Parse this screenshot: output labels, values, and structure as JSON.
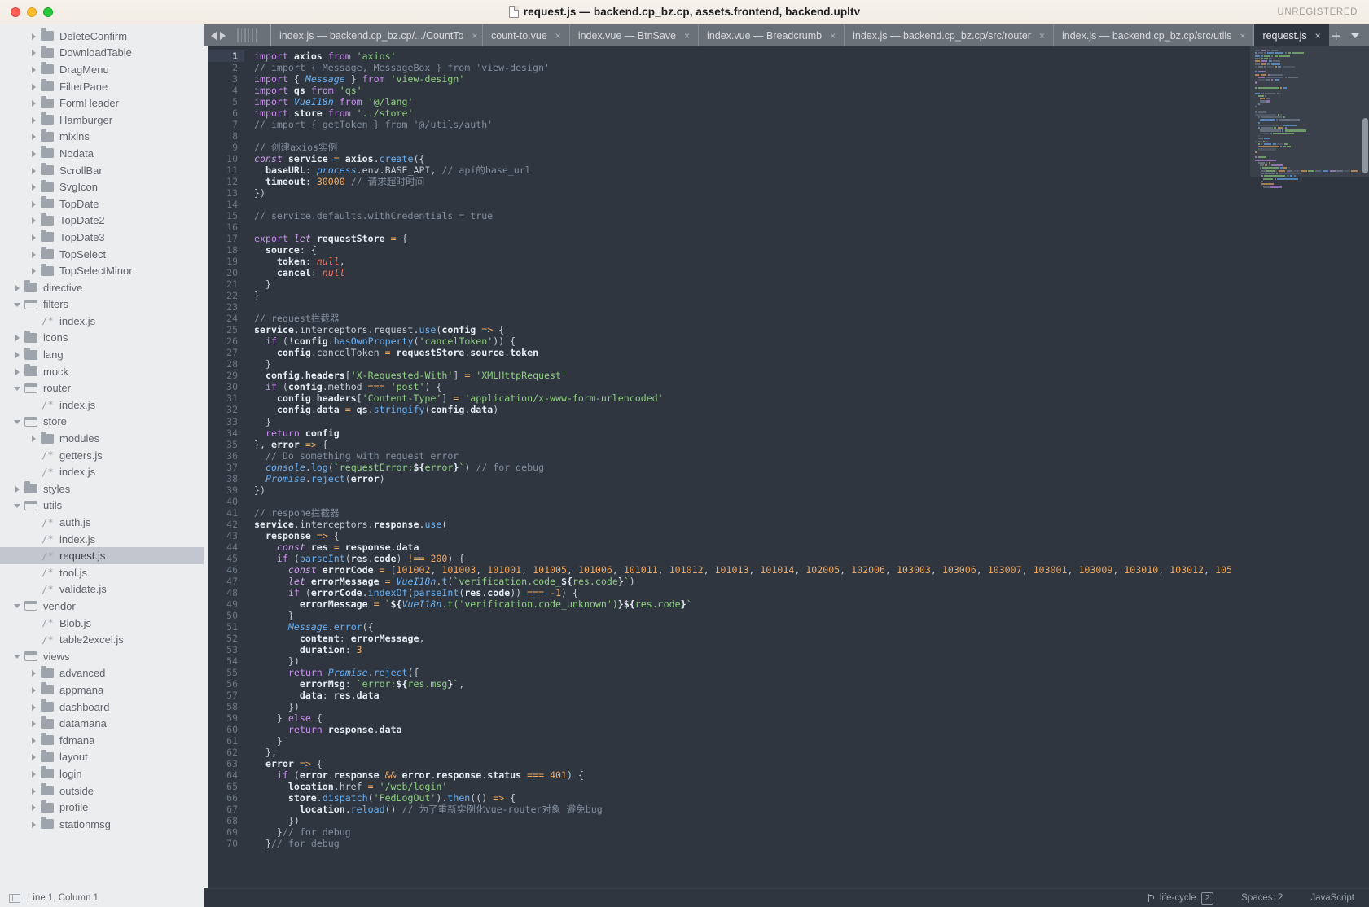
{
  "window": {
    "title": "request.js — backend.cp_bz.cp, assets.frontend, backend.upltv",
    "license": "UNREGISTERED",
    "doc_icon": "document-icon",
    "traffic_lights": [
      "close-button",
      "minimize-button",
      "zoom-button"
    ]
  },
  "sidebar": {
    "items": [
      {
        "label": "DeleteConfirm",
        "type": "folder",
        "state": "collapsed",
        "depth": 2
      },
      {
        "label": "DownloadTable",
        "type": "folder",
        "state": "collapsed",
        "depth": 2
      },
      {
        "label": "DragMenu",
        "type": "folder",
        "state": "collapsed",
        "depth": 2
      },
      {
        "label": "FilterPane",
        "type": "folder",
        "state": "collapsed",
        "depth": 2
      },
      {
        "label": "FormHeader",
        "type": "folder",
        "state": "collapsed",
        "depth": 2
      },
      {
        "label": "Hamburger",
        "type": "folder",
        "state": "collapsed",
        "depth": 2
      },
      {
        "label": "mixins",
        "type": "folder",
        "state": "collapsed",
        "depth": 2
      },
      {
        "label": "Nodata",
        "type": "folder",
        "state": "collapsed",
        "depth": 2
      },
      {
        "label": "ScrollBar",
        "type": "folder",
        "state": "collapsed",
        "depth": 2
      },
      {
        "label": "SvgIcon",
        "type": "folder",
        "state": "collapsed",
        "depth": 2
      },
      {
        "label": "TopDate",
        "type": "folder",
        "state": "collapsed",
        "depth": 2
      },
      {
        "label": "TopDate2",
        "type": "folder",
        "state": "collapsed",
        "depth": 2
      },
      {
        "label": "TopDate3",
        "type": "folder",
        "state": "collapsed",
        "depth": 2
      },
      {
        "label": "TopSelect",
        "type": "folder",
        "state": "collapsed",
        "depth": 2
      },
      {
        "label": "TopSelectMinor",
        "type": "folder",
        "state": "collapsed",
        "depth": 2
      },
      {
        "label": "directive",
        "type": "folder",
        "state": "collapsed",
        "depth": 1
      },
      {
        "label": "filters",
        "type": "folder",
        "state": "expanded",
        "depth": 1
      },
      {
        "label": "index.js",
        "type": "file",
        "state": "none",
        "depth": 2
      },
      {
        "label": "icons",
        "type": "folder",
        "state": "collapsed",
        "depth": 1
      },
      {
        "label": "lang",
        "type": "folder",
        "state": "collapsed",
        "depth": 1
      },
      {
        "label": "mock",
        "type": "folder",
        "state": "collapsed",
        "depth": 1
      },
      {
        "label": "router",
        "type": "folder",
        "state": "expanded",
        "depth": 1
      },
      {
        "label": "index.js",
        "type": "file",
        "state": "none",
        "depth": 2
      },
      {
        "label": "store",
        "type": "folder",
        "state": "expanded",
        "depth": 1
      },
      {
        "label": "modules",
        "type": "folder",
        "state": "collapsed",
        "depth": 2
      },
      {
        "label": "getters.js",
        "type": "file",
        "state": "none",
        "depth": 2
      },
      {
        "label": "index.js",
        "type": "file",
        "state": "none",
        "depth": 2
      },
      {
        "label": "styles",
        "type": "folder",
        "state": "collapsed",
        "depth": 1
      },
      {
        "label": "utils",
        "type": "folder",
        "state": "expanded",
        "depth": 1
      },
      {
        "label": "auth.js",
        "type": "file",
        "state": "none",
        "depth": 2
      },
      {
        "label": "index.js",
        "type": "file",
        "state": "none",
        "depth": 2
      },
      {
        "label": "request.js",
        "type": "file",
        "state": "none",
        "depth": 2,
        "selected": true
      },
      {
        "label": "tool.js",
        "type": "file",
        "state": "none",
        "depth": 2
      },
      {
        "label": "validate.js",
        "type": "file",
        "state": "none",
        "depth": 2
      },
      {
        "label": "vendor",
        "type": "folder",
        "state": "expanded",
        "depth": 1
      },
      {
        "label": "Blob.js",
        "type": "file",
        "state": "none",
        "depth": 2
      },
      {
        "label": "table2excel.js",
        "type": "file",
        "state": "none",
        "depth": 2
      },
      {
        "label": "views",
        "type": "folder",
        "state": "expanded",
        "depth": 1
      },
      {
        "label": "advanced",
        "type": "folder",
        "state": "collapsed",
        "depth": 2
      },
      {
        "label": "appmana",
        "type": "folder",
        "state": "collapsed",
        "depth": 2
      },
      {
        "label": "dashboard",
        "type": "folder",
        "state": "collapsed",
        "depth": 2
      },
      {
        "label": "datamana",
        "type": "folder",
        "state": "collapsed",
        "depth": 2
      },
      {
        "label": "fdmana",
        "type": "folder",
        "state": "collapsed",
        "depth": 2
      },
      {
        "label": "layout",
        "type": "folder",
        "state": "collapsed",
        "depth": 2
      },
      {
        "label": "login",
        "type": "folder",
        "state": "collapsed",
        "depth": 2
      },
      {
        "label": "outside",
        "type": "folder",
        "state": "collapsed",
        "depth": 2
      },
      {
        "label": "profile",
        "type": "folder",
        "state": "collapsed",
        "depth": 2
      },
      {
        "label": "stationmsg",
        "type": "folder",
        "state": "collapsed",
        "depth": 2
      }
    ]
  },
  "tabbar": {
    "nav_prev": "◀",
    "nav_next": "▶",
    "new_tab_label": "+",
    "overflow_label": "▼",
    "tabs": [
      {
        "label": "index.js",
        "clipped": true,
        "active": false,
        "close": "×"
      },
      {
        "label": "index.js — backend.cp_bz.cp/.../CountTo",
        "active": false,
        "close": "×"
      },
      {
        "label": "count-to.vue",
        "active": false,
        "close": "×"
      },
      {
        "label": "index.vue — BtnSave",
        "active": false,
        "close": "×"
      },
      {
        "label": "index.vue — Breadcrumb",
        "active": false,
        "close": "×"
      },
      {
        "label": "index.js — backend.cp_bz.cp/src/router",
        "active": false,
        "close": "×"
      },
      {
        "label": "index.js — backend.cp_bz.cp/src/utils",
        "active": false,
        "close": "×"
      },
      {
        "label": "request.js",
        "active": true,
        "close": "×"
      }
    ]
  },
  "editor": {
    "first_line": 1,
    "cursor_line": 1,
    "lines": [
      "import axios from 'axios'",
      "// import { Message, MessageBox } from 'view-design'",
      "import { Message } from 'view-design'",
      "import qs from 'qs'",
      "import VueI18n from '@/lang'",
      "import store from '../store'",
      "// import { getToken } from '@/utils/auth'",
      "",
      "// 创建axios实例",
      "const service = axios.create({",
      "  baseURL: process.env.BASE_API, // api的base_url",
      "  timeout: 30000 // 请求超时时间",
      "})",
      "",
      "// service.defaults.withCredentials = true",
      "",
      "export let requestStore = {",
      "  source: {",
      "    token: null,",
      "    cancel: null",
      "  }",
      "}",
      "",
      "// request拦截器",
      "service.interceptors.request.use(config => {",
      "  if (!config.hasOwnProperty('cancelToken')) {",
      "    config.cancelToken = requestStore.source.token",
      "  }",
      "  config.headers['X-Requested-With'] = 'XMLHttpRequest'",
      "  if (config.method === 'post') {",
      "    config.headers['Content-Type'] = 'application/x-www-form-urlencoded'",
      "    config.data = qs.stringify(config.data)",
      "  }",
      "  return config",
      "}, error => {",
      "  // Do something with request error",
      "  console.log(`requestError:${error}`) // for debug",
      "  Promise.reject(error)",
      "})",
      "",
      "// respone拦截器",
      "service.interceptors.response.use(",
      "  response => {",
      "    const res = response.data",
      "    if (parseInt(res.code) !== 200) {",
      "      const errorCode = [101002, 101003, 101001, 101005, 101006, 101011, 101012, 101013, 101014, 102005, 102006, 103003, 103006, 103007, 103001, 103009, 103010, 103012, 105",
      "      let errorMessage = VueI18n.t(`verification.code_${res.code}`)",
      "      if (errorCode.indexOf(parseInt(res.code)) === -1) {",
      "        errorMessage = `${VueI18n.t('verification.code_unknown')}${res.code}`",
      "      }",
      "      Message.error({",
      "        content: errorMessage,",
      "        duration: 3",
      "      })",
      "      return Promise.reject({",
      "        errorMsg: `error:${res.msg}`,",
      "        data: res.data",
      "      })",
      "    } else {",
      "      return response.data",
      "    }",
      "  },",
      "  error => {",
      "    if (error.response && error.response.status === 401) {",
      "      location.href = '/web/login'",
      "      store.dispatch('FedLogOut').then(() => {",
      "        location.reload() // 为了重新实例化vue-router对象 避免bug",
      "      })",
      "    }// for debug"
    ]
  },
  "statusbar": {
    "cursor_position": "Line 1, Column 1",
    "branch": "life-cycle",
    "branch_count": "2",
    "indentation": "Spaces: 2",
    "syntax": "JavaScript"
  },
  "colors": {
    "titlebar_bg": "#f4eee7",
    "sidebar_bg": "#ecedef",
    "sidebar_selected": "#c2c6cf",
    "tabbar_bg": "#6b7179",
    "editor_bg": "#2f3640",
    "keyword": "#c792ea",
    "string": "#8fcf7f",
    "comment": "#828e9c",
    "number": "#f0a860",
    "function": "#6ab0f3"
  }
}
